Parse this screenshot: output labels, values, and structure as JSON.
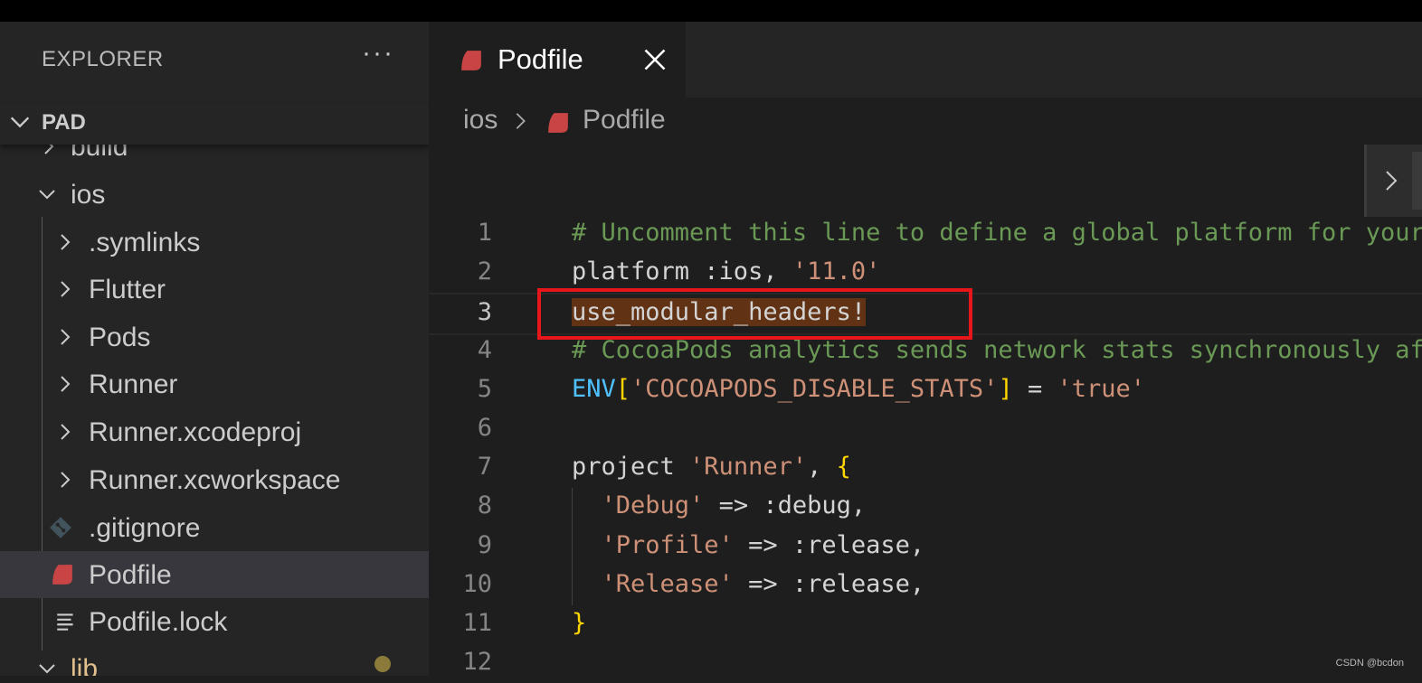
{
  "explorer": {
    "title": "EXPLORER",
    "more": "···",
    "section": "PAD",
    "items": [
      {
        "label": "build",
        "type": "folder"
      },
      {
        "label": "ios",
        "type": "folder-open"
      },
      {
        "label": ".symlinks",
        "type": "folder"
      },
      {
        "label": "Flutter",
        "type": "folder"
      },
      {
        "label": "Pods",
        "type": "folder"
      },
      {
        "label": "Runner",
        "type": "folder"
      },
      {
        "label": "Runner.xcodeproj",
        "type": "folder"
      },
      {
        "label": "Runner.xcworkspace",
        "type": "folder"
      },
      {
        "label": ".gitignore",
        "type": "git-icon"
      },
      {
        "label": "Podfile",
        "type": "ruby-icon",
        "selected": true
      },
      {
        "label": "Podfile.lock",
        "type": "lines-icon"
      },
      {
        "label": "lib",
        "type": "folder-open"
      }
    ]
  },
  "tab": {
    "label": "Podfile",
    "icon": "ruby-icon"
  },
  "breadcrumb": {
    "folder": "ios",
    "file": "Podfile"
  },
  "editor": {
    "active_line": 3,
    "lines": [
      {
        "n": "1",
        "tokens": [
          {
            "t": "# Uncomment this line to define a global platform for your project",
            "c": "c-comment"
          }
        ]
      },
      {
        "n": "2",
        "tokens": [
          {
            "t": "platform :ios, ",
            "c": "c-plain"
          },
          {
            "t": "'11.0'",
            "c": "c-str"
          }
        ]
      },
      {
        "n": "3",
        "tokens": [
          {
            "t": "use_modular_headers!",
            "c": "c-plain hl"
          }
        ]
      },
      {
        "n": "4",
        "tokens": [
          {
            "t": "# CocoaPods analytics sends network stats synchronously affecting flutter build latency.",
            "c": "c-comment"
          }
        ]
      },
      {
        "n": "5",
        "tokens": [
          {
            "t": "ENV",
            "c": "c-const"
          },
          {
            "t": "[",
            "c": "c-brace"
          },
          {
            "t": "'COCOAPODS_DISABLE_STATS'",
            "c": "c-str"
          },
          {
            "t": "]",
            "c": "c-brace"
          },
          {
            "t": " = ",
            "c": "c-plain"
          },
          {
            "t": "'true'",
            "c": "c-str"
          }
        ]
      },
      {
        "n": "6",
        "tokens": []
      },
      {
        "n": "7",
        "tokens": [
          {
            "t": "project ",
            "c": "c-plain"
          },
          {
            "t": "'Runner'",
            "c": "c-str"
          },
          {
            "t": ", ",
            "c": "c-plain"
          },
          {
            "t": "{",
            "c": "c-brace"
          }
        ]
      },
      {
        "n": "8",
        "tokens": [
          {
            "t": "  ",
            "c": "c-plain"
          },
          {
            "t": "'Debug'",
            "c": "c-str"
          },
          {
            "t": " => :debug,",
            "c": "c-plain"
          }
        ]
      },
      {
        "n": "9",
        "tokens": [
          {
            "t": "  ",
            "c": "c-plain"
          },
          {
            "t": "'Profile'",
            "c": "c-str"
          },
          {
            "t": " => :release,",
            "c": "c-plain"
          }
        ]
      },
      {
        "n": "10",
        "tokens": [
          {
            "t": "  ",
            "c": "c-plain"
          },
          {
            "t": "'Release'",
            "c": "c-str"
          },
          {
            "t": " => :release,",
            "c": "c-plain"
          }
        ]
      },
      {
        "n": "11",
        "tokens": [
          {
            "t": "}",
            "c": "c-brace"
          }
        ]
      },
      {
        "n": "12",
        "tokens": []
      }
    ]
  },
  "watermark": "CSDN @bcdon",
  "colors": {
    "highlight_box": "#e8151b",
    "ruby_icon": "#c94545"
  }
}
